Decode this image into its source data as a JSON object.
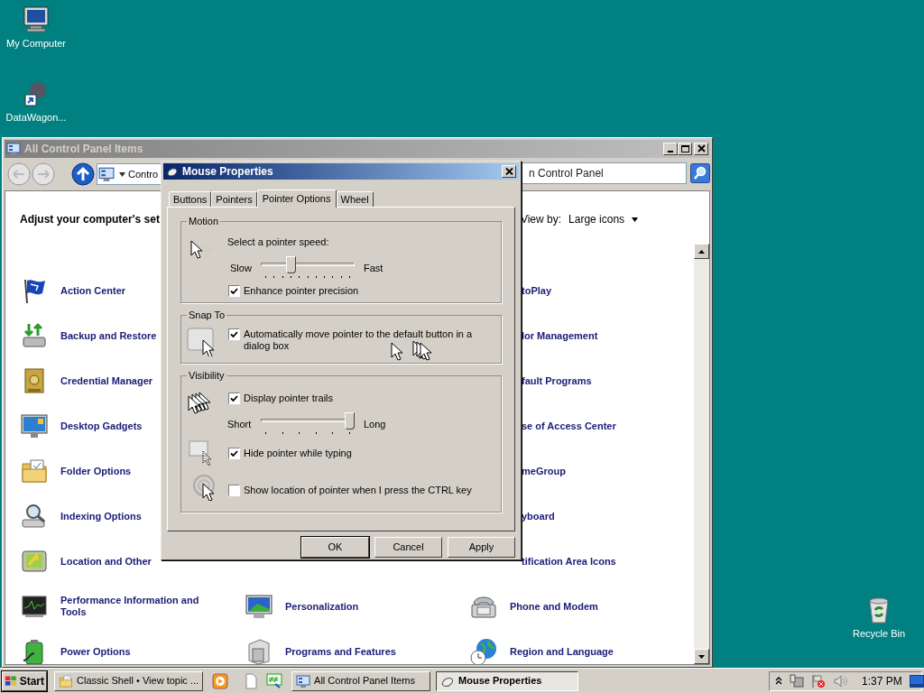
{
  "desktop_icons": [
    {
      "kind": "computer",
      "label": "My Computer"
    },
    {
      "kind": "shortcut",
      "label": "DataWagon..."
    },
    {
      "kind": "recycle",
      "label": "Recycle Bin"
    }
  ],
  "control_panel": {
    "title": "All Control Panel Items",
    "address": "Contro",
    "search": "n Control Panel",
    "heading": "Adjust your computer's set",
    "view_by_label": "View by:",
    "view_by_value": "Large icons",
    "columns": [
      [
        {
          "kind": "flag",
          "label": "Action Center"
        },
        {
          "kind": "backup",
          "label": "Backup and Restore"
        },
        {
          "kind": "credential",
          "label": "Credential Manager"
        },
        {
          "kind": "gadgets",
          "label": "Desktop Gadgets"
        },
        {
          "kind": "folder",
          "label": "Folder Options"
        },
        {
          "kind": "indexing",
          "label": "Indexing Options"
        },
        {
          "kind": "location",
          "label": "Location and Other"
        },
        {
          "kind": "performance",
          "label": "Performance Information and Tools"
        },
        {
          "kind": "power",
          "label": "Power Options"
        }
      ],
      [
        {
          "kind": "personalization",
          "label": "Personalization"
        },
        {
          "kind": "programs",
          "label": "Programs and Features"
        }
      ],
      [
        {
          "label": "toPlay"
        },
        {
          "label": "lor Management"
        },
        {
          "label": "fault Programs"
        },
        {
          "label": "se of Access Center"
        },
        {
          "label": "meGroup"
        },
        {
          "label": "yboard"
        },
        {
          "label": "tification Area Icons"
        },
        {
          "kind": "phone",
          "label": "Phone and Modem"
        },
        {
          "kind": "globe",
          "label": "Region and Language"
        }
      ]
    ]
  },
  "dialog": {
    "title": "Mouse Properties",
    "tabs": [
      {
        "label": "Buttons",
        "selected": false
      },
      {
        "label": "Pointers",
        "selected": false
      },
      {
        "label": "Pointer Options",
        "selected": true
      },
      {
        "label": "Wheel",
        "selected": false
      }
    ],
    "motion": {
      "title": "Motion",
      "prompt": "Select a pointer speed:",
      "min_label": "Slow",
      "max_label": "Fast",
      "level": 0.3,
      "precision": {
        "label": "Enhance pointer precision",
        "checked": true
      }
    },
    "snap_to": {
      "title": "Snap To",
      "option": {
        "label": "Automatically move pointer to the default button in a dialog box",
        "checked": true
      }
    },
    "visibility": {
      "title": "Visibility",
      "trails": {
        "label": "Display pointer trails",
        "checked": true
      },
      "min_label": "Short",
      "max_label": "Long",
      "level": 1,
      "hide": {
        "label": "Hide pointer while typing",
        "checked": true
      },
      "locate": {
        "label": "Show location of pointer when I press the CTRL key",
        "checked": false
      }
    },
    "buttons": [
      {
        "label": "OK",
        "default": true
      },
      {
        "label": "Cancel",
        "default": false
      },
      {
        "label": "Apply",
        "default": false
      }
    ]
  },
  "taskbar": {
    "start": "Start",
    "tasks": [
      {
        "kind": "folder",
        "label": "Classic Shell • View topic ...",
        "selected": false
      },
      {
        "kind": "panel",
        "label": "All Control Panel Items",
        "selected": false
      },
      {
        "kind": "mouse",
        "label": "Mouse Properties",
        "selected": true
      }
    ],
    "clock": "1:37 PM"
  }
}
